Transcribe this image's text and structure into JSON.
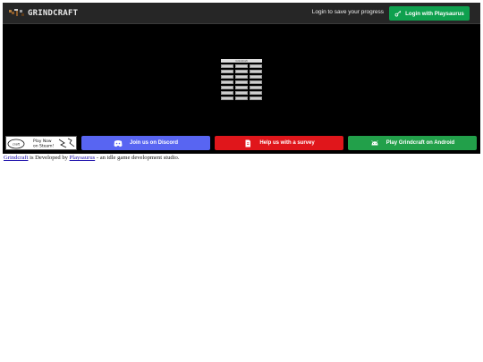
{
  "header": {
    "logo_text": "GRINDCRAFT",
    "login_prompt": "Login to save your progress",
    "login_button": "Login with Playsaurus"
  },
  "game": {
    "title": "Grindcraft",
    "tiles": [
      "",
      "",
      "",
      "",
      "",
      "",
      "",
      "",
      "",
      "",
      "",
      "",
      "",
      "",
      "",
      "",
      "",
      "",
      "",
      "",
      ""
    ]
  },
  "bottom": {
    "steam_badge_text": "Play Now on Steam!",
    "discord_button": "Join us on Discord",
    "survey_button": "Help us with a survey",
    "android_button": "Play Grindcraft on Android"
  },
  "footer": {
    "link1": "Grindcraft",
    "text1": " is Developed by ",
    "link2": "Playsaurus",
    "text2": " - an idle game development studio."
  },
  "colors": {
    "login_button": "#0fa04e",
    "discord": "#5865f2",
    "survey": "#e0161b",
    "android": "#22a04a"
  }
}
